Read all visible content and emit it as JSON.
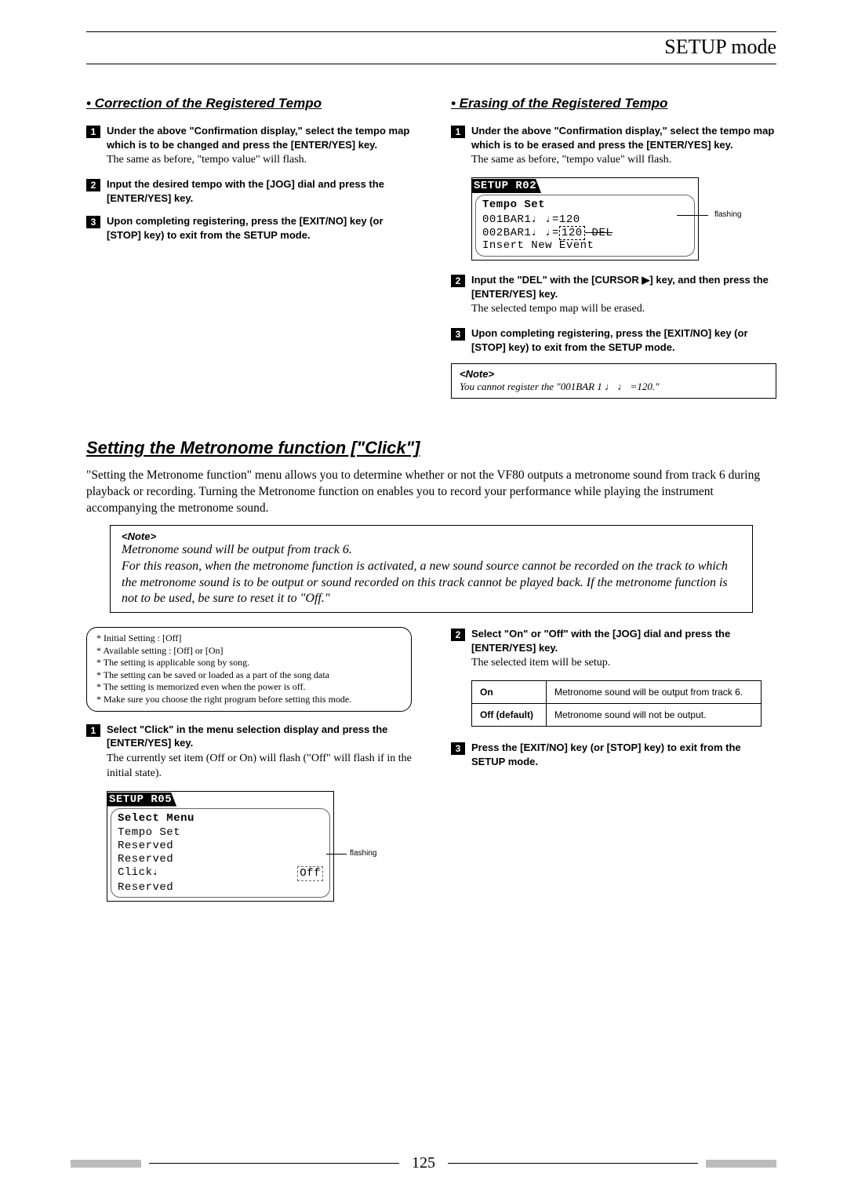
{
  "header": "SETUP mode",
  "page_number": "125",
  "left": {
    "heading": "• Correction of the Registered Tempo",
    "s1": {
      "bold": "Under the above \"Confirmation display,\" select the tempo map which is to be changed and press the [ENTER/YES] key.",
      "plain": "The same as before, \"tempo value\" will flash."
    },
    "s2": {
      "bold": "Input the desired tempo with the [JOG] dial and press the [ENTER/YES] key."
    },
    "s3": {
      "bold": "Upon completing registering, press the [EXIT/NO] key (or [STOP] key) to exit from the SETUP mode."
    }
  },
  "right": {
    "heading": "• Erasing of the Registered Tempo",
    "s1": {
      "bold": "Under the above \"Confirmation display,\" select the tempo map which is to be erased and press the [ENTER/YES] key.",
      "plain": "The same as before, \"tempo value\" will flash."
    },
    "lcd": {
      "tab": "SETUP R02",
      "title": "Tempo Set",
      "l1": "001BAR1♩ ♩=120",
      "l2a": "002BAR1♩ ♩=",
      "l2b": "120",
      "l2c": " DEL",
      "l3": "Insert New Event",
      "flash": "flashing"
    },
    "s2": {
      "bold": "Input the \"DEL\" with the [CURSOR ▶] key, and then press the [ENTER/YES] key.",
      "plain": "The selected tempo map will be erased."
    },
    "s3": {
      "bold": "Upon completing registering, press the [EXIT/NO] key (or [STOP] key) to exit from the SETUP mode."
    },
    "note": {
      "title": "<Note>",
      "body": "You cannot register the \"001BAR 1 ♩ ♩ =120.\""
    }
  },
  "metronome": {
    "heading": "Setting the Metronome function [\"Click\"]",
    "lead": "\"Setting the Metronome function\" menu allows you to determine whether or not the VF80 outputs a metronome sound from track 6 during playback or recording.  Turning the Metronome function on enables you to record your performance while playing the instrument accompanying the metronome sound.",
    "note": {
      "title": "<Note>",
      "body": "Metronome sound will be output from track 6.\nFor this reason, when the metronome function is activated, a new sound source cannot be recorded on the track to which the metronome sound is to be output or sound recorded on this track cannot be played back. If the metronome function is not to be used, be sure to reset it to \"Off.\""
    },
    "specs": {
      "l1": "* Initial Setting               :  [Off]",
      "l2": "* Available setting            :  [Off] or [On]",
      "l3": "* The setting is applicable song by song.",
      "l4": "* The setting can be saved or loaded as a part of the song data",
      "l5": "* The setting is memorized even when the power is off.",
      "l6": "* Make sure you choose the right program before setting this mode."
    },
    "s1": {
      "bold": "Select \"Click\" in the menu selection display and press the [ENTER/YES] key.",
      "plain": "The currently set item (Off or On) will flash (\"Off\" will flash if in the initial state)."
    },
    "lcd": {
      "tab": "SETUP R05",
      "title": "Select Menu",
      "l1": "Tempo Set",
      "l2": "Reserved",
      "l3": "Reserved",
      "l4a": "Click♩",
      "l4b": "Off",
      "l5": "Reserved",
      "flash": "flashing"
    },
    "s2": {
      "bold": "Select \"On\" or \"Off\" with the [JOG] dial and press the [ENTER/YES] key.",
      "plain": "The selected item will be setup."
    },
    "table": {
      "r1k": "On",
      "r1v": "Metronome sound will be output from track 6.",
      "r2k": "Off (default)",
      "r2v": "Metronome sound will not be output."
    },
    "s3": {
      "bold": "Press the [EXIT/NO] key (or [STOP] key) to exit from the SETUP mode."
    }
  }
}
